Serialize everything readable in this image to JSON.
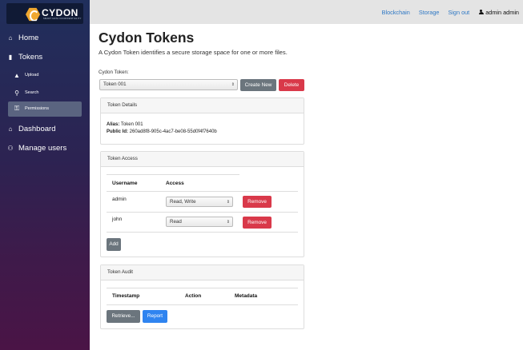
{
  "brand": {
    "name": "CYDON",
    "tagline": "SMART DATA CONFIDENTIALITY"
  },
  "sidebar": {
    "items": [
      {
        "label": "Home",
        "icon": "home-icon"
      },
      {
        "label": "Tokens",
        "icon": "file-icon"
      },
      {
        "label": "Upload",
        "icon": "upload-icon"
      },
      {
        "label": "Search",
        "icon": "search-icon"
      },
      {
        "label": "Permissions",
        "icon": "key-icon"
      },
      {
        "label": "Dashboard",
        "icon": "home-icon"
      },
      {
        "label": "Manage users",
        "icon": "users-icon"
      }
    ]
  },
  "topbar": {
    "links": [
      "Blockchain",
      "Storage",
      "Sign out"
    ],
    "user": "admin admin"
  },
  "page": {
    "title": "Cydon Tokens",
    "subtitle": "A Cydon Token identifies a secure storage space for one or more files.",
    "token_label": "Cydon Token:",
    "token_selected": "Token 001",
    "create_button": "Create New",
    "delete_button": "Delete"
  },
  "details": {
    "header": "Token Details",
    "alias_label": "Alias:",
    "alias_value": "Token 001",
    "public_id_label": "Public Id:",
    "public_id_value": "260ad8f8-905c-4ac7-be08-55d0f4f7640b"
  },
  "access": {
    "header": "Token Access",
    "columns": [
      "Username",
      "Access"
    ],
    "rows": [
      {
        "username": "admin",
        "access": "Read, Write",
        "action": "Remove"
      },
      {
        "username": "john",
        "access": "Read",
        "action": "Remove"
      }
    ],
    "add_button": "Add"
  },
  "audit": {
    "header": "Token Audit",
    "columns": [
      "Timestamp",
      "Action",
      "Metadata"
    ],
    "retrieve_button": "Retrieve...",
    "report_button": "Report"
  },
  "colors": {
    "link": "#2f78c4",
    "danger": "#d9394a",
    "primary": "#2f84f0",
    "secondary": "#6b757d",
    "sidebar_top": "#202f5c",
    "sidebar_bottom": "#4a1446",
    "brand_accent": "#f0a830"
  }
}
